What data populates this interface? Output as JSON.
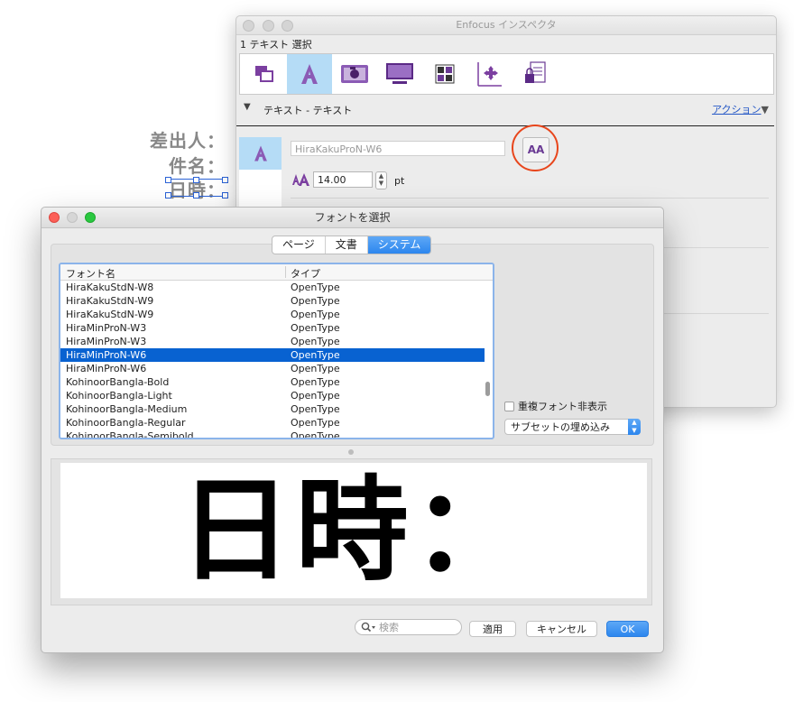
{
  "document": {
    "lines": [
      "差出人：",
      "件名：",
      "日時："
    ]
  },
  "inspector": {
    "title": "Enfocus インスペクタ",
    "selection_count": "1 テキスト 選択",
    "section_label": "テキスト - テキスト",
    "action_link": "アクション",
    "font_name": "HiraKakuProN-W6",
    "font_size": "14.00",
    "size_unit": "pt",
    "aa_button_label": "AA"
  },
  "font_dialog": {
    "title": "フォントを選択",
    "tabs": [
      "ページ",
      "文書",
      "システム"
    ],
    "selected_tab": "システム",
    "columns": [
      "フォント名",
      "タイプ"
    ],
    "rows": [
      {
        "name": "HiraKakuStdN-W8",
        "type": "OpenType"
      },
      {
        "name": "HiraKakuStdN-W9",
        "type": "OpenType"
      },
      {
        "name": "HiraKakuStdN-W9",
        "type": "OpenType"
      },
      {
        "name": "HiraMinProN-W3",
        "type": "OpenType"
      },
      {
        "name": "HiraMinProN-W3",
        "type": "OpenType"
      },
      {
        "name": "HiraMinProN-W6",
        "type": "OpenType",
        "selected": true
      },
      {
        "name": "HiraMinProN-W6",
        "type": "OpenType"
      },
      {
        "name": "KohinoorBangla-Bold",
        "type": "OpenType"
      },
      {
        "name": "KohinoorBangla-Light",
        "type": "OpenType"
      },
      {
        "name": "KohinoorBangla-Medium",
        "type": "OpenType"
      },
      {
        "name": "KohinoorBangla-Regular",
        "type": "OpenType"
      },
      {
        "name": "KohinoorBangla-Semibold",
        "type": "OpenType"
      }
    ],
    "hide_duplicates_label": "重複フォント非表示",
    "hide_duplicates_checked": false,
    "subset_option": "サブセットの埋め込み",
    "preview_text": "日時：",
    "search_placeholder": "検索",
    "apply_button": "適用",
    "cancel_button": "キャンセル",
    "ok_button": "OK"
  },
  "colors": {
    "accent": "#2c86ee",
    "selection_row": "#0862d1",
    "tool_active": "#b5dcf6",
    "icon_purple": "#7b3fa0",
    "highlight_circle": "#e8461c"
  }
}
